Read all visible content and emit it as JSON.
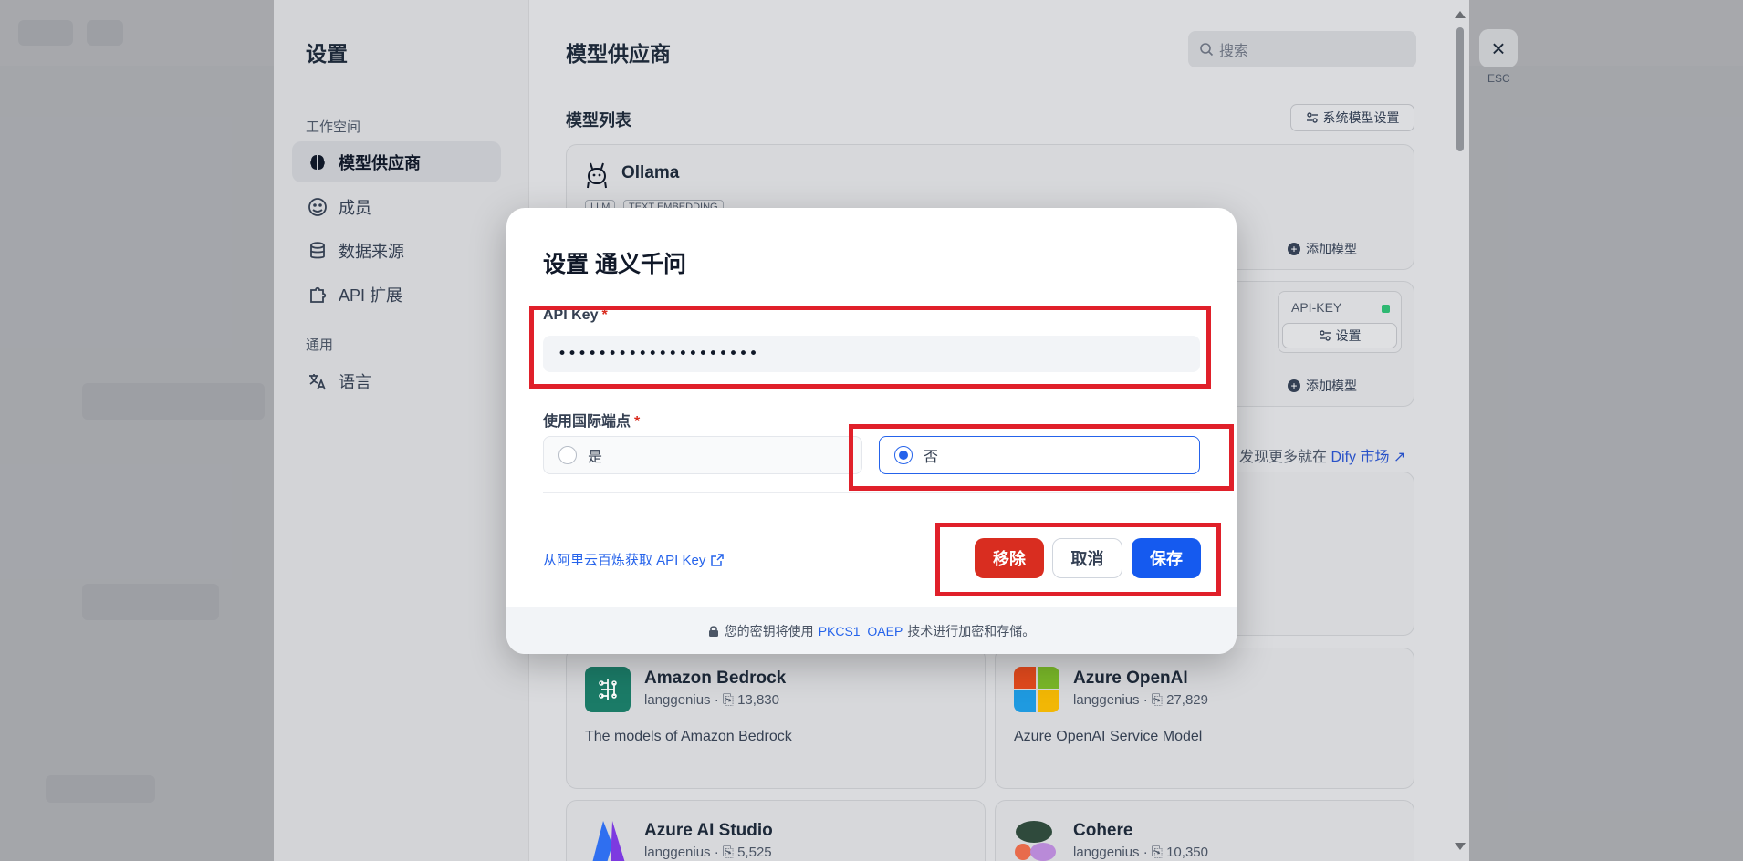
{
  "settings": {
    "title": "设置",
    "group_workspace": "工作空间",
    "group_general": "通用",
    "nav": [
      {
        "label": "模型供应商",
        "icon": "brain-icon"
      },
      {
        "label": "成员",
        "icon": "members-icon"
      },
      {
        "label": "数据来源",
        "icon": "database-icon"
      },
      {
        "label": "API 扩展",
        "icon": "puzzle-icon"
      },
      {
        "label": "语言",
        "icon": "translate-icon"
      }
    ],
    "esc_label": "ESC"
  },
  "main": {
    "page_title": "模型供应商",
    "search_placeholder": "搜索",
    "section_label": "模型列表",
    "system_model_btn": "系统模型设置",
    "providers": [
      {
        "name": "Ollama",
        "tags": [
          "LLM",
          "TEXT EMBEDDING"
        ],
        "add_model": "添加模型"
      },
      {
        "name": "",
        "add_model": "添加模型",
        "api_key_label": "API-KEY",
        "setup_label": "设置"
      }
    ],
    "market_prefix": "发现更多就在",
    "market_link": "Dify 市场",
    "plugins": [
      {
        "name": "Amazon Bedrock",
        "author": "langgenius",
        "installs": "13,830",
        "desc": "The models of Amazon Bedrock"
      },
      {
        "name": "Azure OpenAI",
        "author": "langgenius",
        "installs": "27,829",
        "desc": "Azure OpenAI Service Model"
      },
      {
        "name": "Azure AI Studio",
        "author": "langgenius",
        "installs": "5,525",
        "desc": ""
      },
      {
        "name": "Cohere",
        "author": "langgenius",
        "installs": "10,350",
        "desc": ""
      }
    ]
  },
  "dialog": {
    "title": "设置 通义千问",
    "api_key_label": "API Key",
    "required_mark": "*",
    "api_key_value": "••••••••••••••••••••",
    "endpoint_label": "使用国际端点",
    "option_yes": "是",
    "option_no": "否",
    "selected": "否",
    "help_link": "从阿里云百炼获取 API Key",
    "btn_remove": "移除",
    "btn_cancel": "取消",
    "btn_save": "保存",
    "footer_prefix": "您的密钥将使用",
    "footer_highlight": "PKCS1_OAEP",
    "footer_suffix": "技术进行加密和存储。"
  },
  "colors": {
    "primary": "#155aef",
    "danger": "#d92d20",
    "annotation": "#e0202a"
  }
}
